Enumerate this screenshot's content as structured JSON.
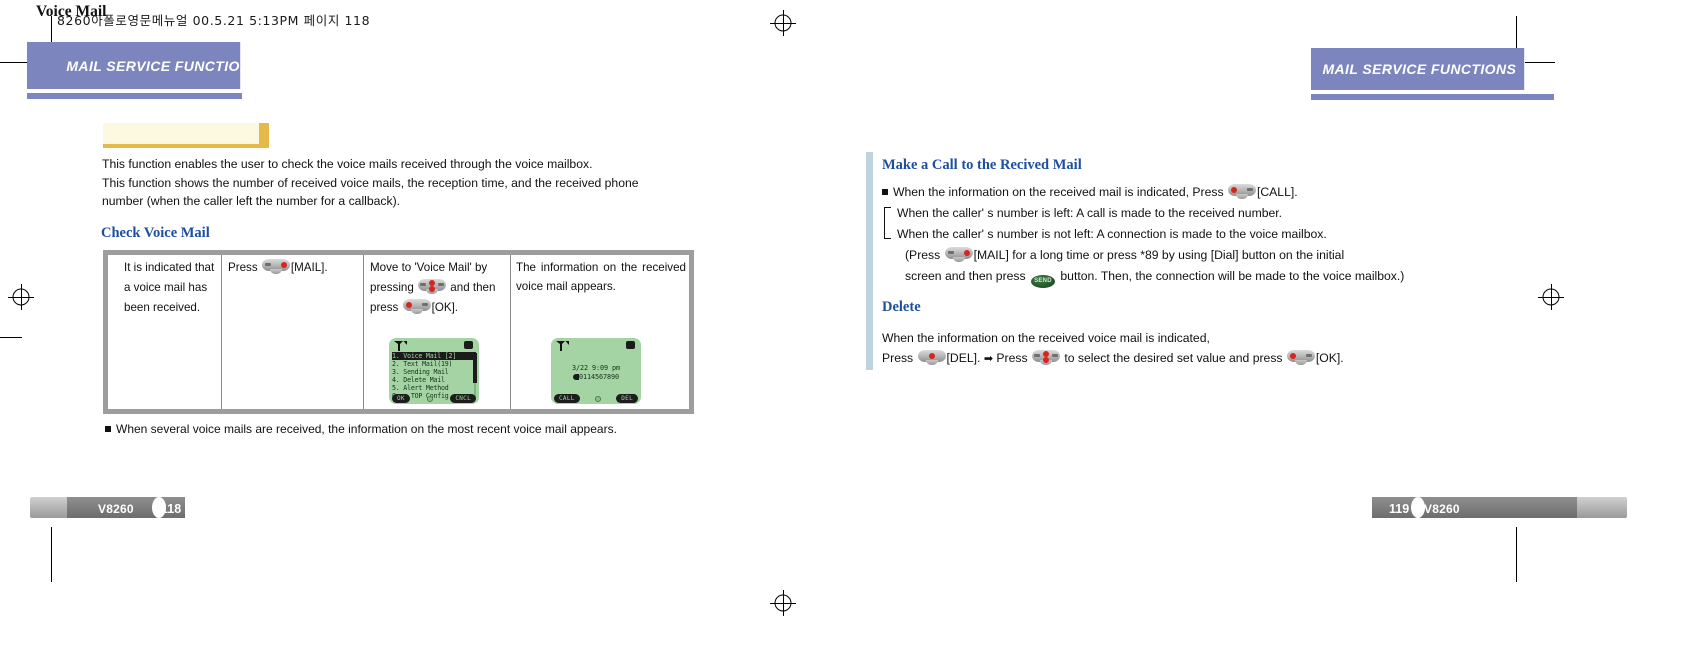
{
  "scan_header": "8260아폴로영문메뉴얼   00.5.21 5:13PM 페이지 118",
  "left_page": {
    "banner": "MAIL SERVICE FUNCTIONS",
    "tab_title": "Voice Mail",
    "intro_lines": [
      "This function enables  the user  to check  the voice  mails received through  the voice mailbox.",
      "This function shows   the number of   received voice mails,   the reception time, and the received phone",
      "number (when the caller left the number for a callback)."
    ],
    "subhead": "Check Voice Mail",
    "table": {
      "cells": [
        [
          "It is indicated that",
          "a voice mail has",
          "been received."
        ],
        [
          "Press",
          "[MAIL]."
        ],
        [
          "Move to  'Voice Mail' by",
          "pressing",
          "and then",
          "press",
          "[OK]."
        ],
        [
          "The  information  on  the",
          "received    voice    mail",
          "appears."
        ]
      ],
      "cell1_line1": "It is indicated that",
      "cell1_line2": "a voice mail has",
      "cell1_line3": "been received.",
      "cell2_pre": "Press",
      "cell2_post": "[MAIL].",
      "cell3_line1": "Move to  'Voice Mail' by",
      "cell3_pre2": "pressing",
      "cell3_post2": "and then",
      "cell3_pre3": "press",
      "cell3_post3": "[OK].",
      "cell4_text": "The information on the received voice mail appears."
    },
    "lcd_menu": {
      "items": [
        "1. Voice  Mail [2]",
        "2. Text  Mail(19)",
        "3. Sending  Mail",
        "4. Delete  Mail",
        "5. Alert  Method",
        "0. m.TOP Config"
      ],
      "soft_left": "OK",
      "soft_right": "CNCL"
    },
    "lcd_info": {
      "line1": "3/22  9:09  pm",
      "line2": "0114567890",
      "soft_left": "CALL",
      "soft_right": "DEL"
    },
    "note": "When several voice mails are received, the information on the  most recent voice mail appears.",
    "footer_model": "V8260",
    "footer_page": "118"
  },
  "right_page": {
    "banner": "MAIL SERVICE FUNCTIONS",
    "subhead_call": "Make a Call to the Recived Mail",
    "bullet1_pre": "When the information on the received mail is indicated, Press",
    "bullet1_post": "[CALL].",
    "sub1": "When the caller' s number is left: A call is made to the received number.",
    "sub2": "When the caller' s number is not left: A connection is made to the voice mailbox.",
    "paren_pre": "(Press",
    "paren_mid": "[MAIL] for a  long time or  press *89 by  using [Dial] button  on the initial",
    "paren2_pre": "screen and then  press",
    "paren2_post": "button.  Then, the  connection will  be made  to the  voice mailbox.)",
    "subhead_delete": "Delete",
    "del_line1": "When the information on the received voice mail is indicated,",
    "del_pre": "Press",
    "del_mid1": "[DEL].",
    "del_arrow": "➡",
    "del_mid2": "Press",
    "del_mid3": "to select the desired set value and press",
    "del_end": "[OK].",
    "footer_model": "V8260",
    "footer_page": "119"
  }
}
